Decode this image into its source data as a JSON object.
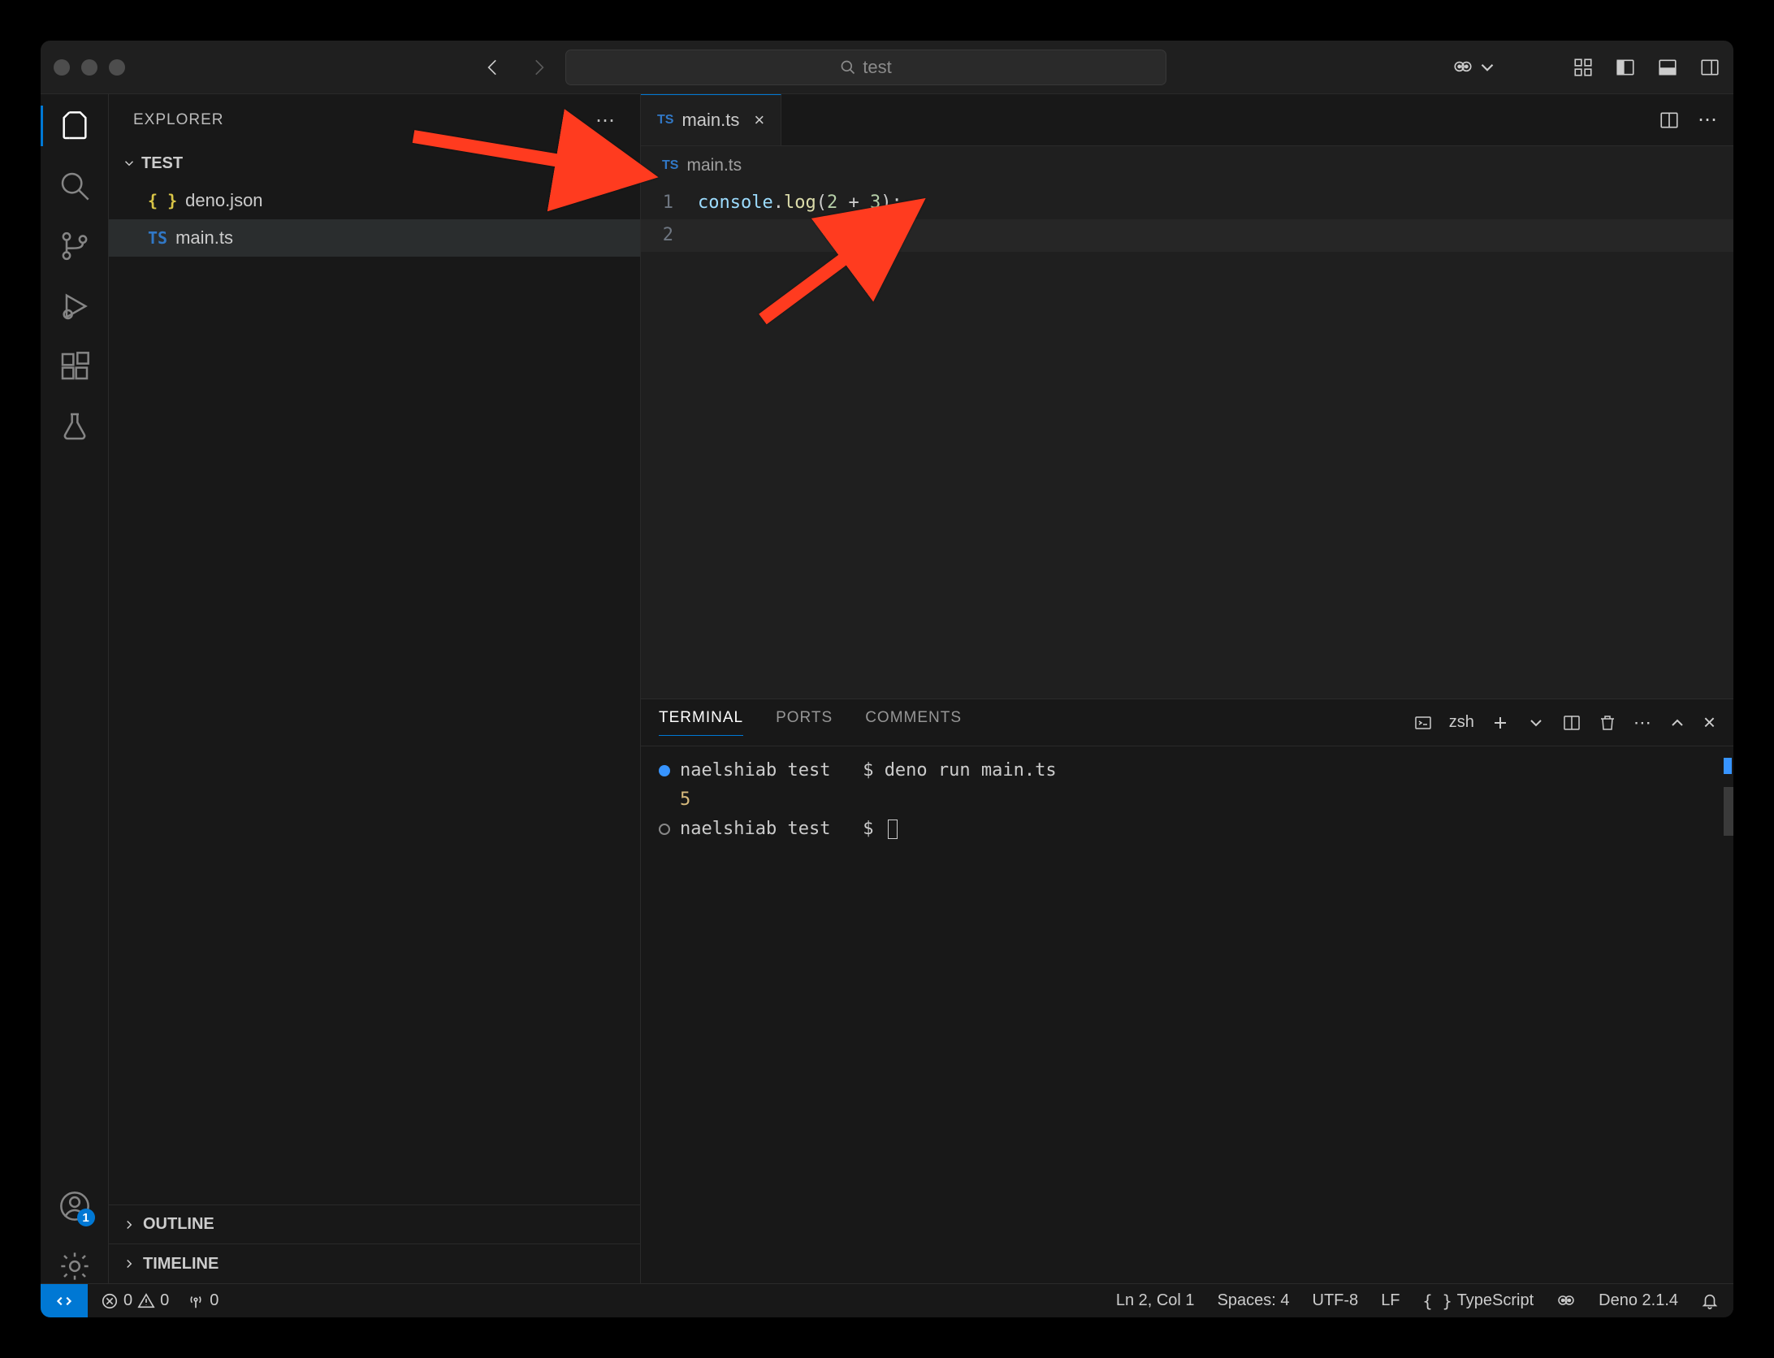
{
  "titlebar": {
    "search_placeholder": "test"
  },
  "sidebar": {
    "title": "EXPLORER",
    "folder": "TEST",
    "files": [
      {
        "icon": "{ }",
        "iconClass": "ficon-json",
        "name": "deno.json"
      },
      {
        "icon": "TS",
        "iconClass": "ficon-ts",
        "name": "main.ts",
        "selected": true
      }
    ],
    "outline": "OUTLINE",
    "timeline": "TIMELINE"
  },
  "accounts_badge": "1",
  "tabs": {
    "active": {
      "icon": "TS",
      "label": "main.ts"
    }
  },
  "breadcrumb": {
    "icon": "TS",
    "label": "main.ts"
  },
  "editor": {
    "lines": [
      {
        "n": "1",
        "tokens": [
          {
            "t": "console",
            "c": "tok-obj"
          },
          {
            "t": ".",
            "c": "tok-punc"
          },
          {
            "t": "log",
            "c": "tok-func"
          },
          {
            "t": "(",
            "c": "tok-punc"
          },
          {
            "t": "2",
            "c": "tok-num"
          },
          {
            "t": " + ",
            "c": "tok-punc"
          },
          {
            "t": "3",
            "c": "tok-num"
          },
          {
            "t": ")",
            "c": "tok-punc"
          },
          {
            "t": ";",
            "c": "tok-punc"
          }
        ]
      },
      {
        "n": "2",
        "tokens": [],
        "current": true
      }
    ]
  },
  "panel": {
    "tabs": [
      "TERMINAL",
      "PORTS",
      "COMMENTS"
    ],
    "active": "TERMINAL",
    "shell": "zsh",
    "lines": [
      {
        "bullet": "blue",
        "user": "naelshiab",
        "path": "test",
        "sep": "$",
        "cmd": "deno run main.ts"
      },
      {
        "out": "5",
        "outClass": "term-out-yellow"
      },
      {
        "bullet": "hollow",
        "user": "naelshiab",
        "path": "test",
        "sep": "$",
        "cursor": true
      }
    ]
  },
  "status": {
    "errors": "0",
    "warnings": "0",
    "ports": "0",
    "ln_col": "Ln 2, Col 1",
    "spaces": "Spaces: 4",
    "encoding": "UTF-8",
    "eol": "LF",
    "lang": "TypeScript",
    "runtime": "Deno 2.1.4"
  }
}
